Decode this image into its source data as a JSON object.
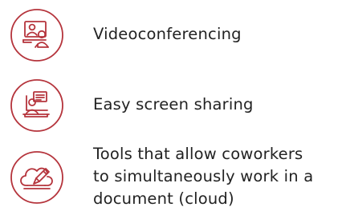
{
  "accent_color": "#b5343c",
  "text_color": "#222222",
  "features": [
    {
      "icon": "videoconference-icon",
      "label": "Videoconferencing"
    },
    {
      "icon": "screen-share-icon",
      "label": "Easy screen sharing"
    },
    {
      "icon": "cloud-edit-icon",
      "label_lines": [
        "Tools that allow coworkers",
        "to simultaneously work in a",
        "document (cloud)"
      ]
    }
  ]
}
